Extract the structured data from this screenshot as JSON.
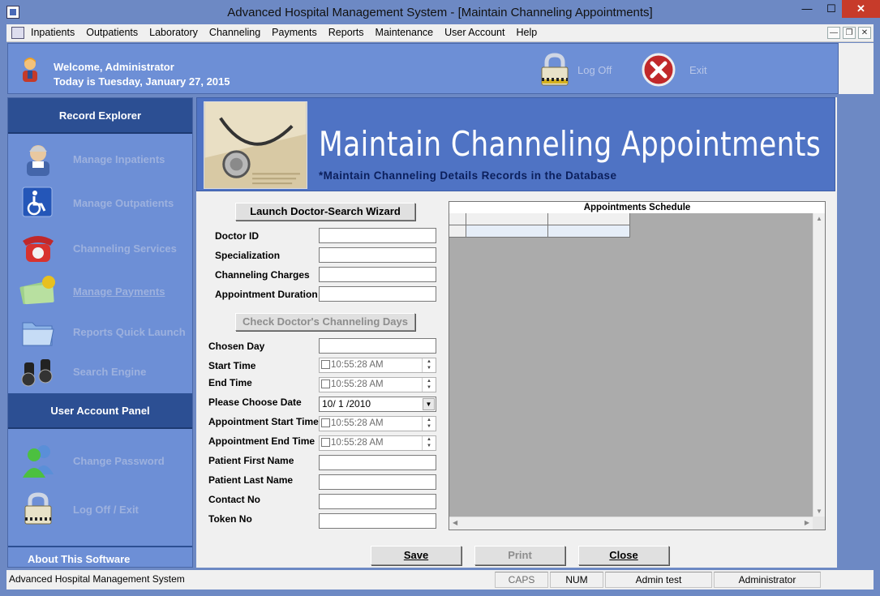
{
  "window": {
    "title": "Advanced Hospital Management System - [Maintain Channeling Appointments]",
    "minimize": "—",
    "maximize": "☐",
    "close": "✕"
  },
  "menu": {
    "items": [
      "Inpatients",
      "Outpatients",
      "Laboratory",
      "Channeling",
      "Payments",
      "Reports",
      "Maintenance",
      "User Account",
      "Help"
    ],
    "mdi_min": "—",
    "mdi_restore": "❐",
    "mdi_close": "✕"
  },
  "header": {
    "welcome": "Welcome, Administrator",
    "date": "Today is Tuesday, January 27, 2015",
    "logoff_label": "Log Off",
    "exit_label": "Exit"
  },
  "sidebar": {
    "record_explorer_title": "Record Explorer",
    "record_items": [
      {
        "label": "Manage Inpatients",
        "icon": "nurse-icon"
      },
      {
        "label": "Manage Outpatients",
        "icon": "wheelchair-icon"
      },
      {
        "label": "Channeling Services",
        "icon": "telephone-icon"
      },
      {
        "label": "Manage Payments",
        "icon": "money-icon"
      },
      {
        "label": "Reports Quick Launch",
        "icon": "folder-icon"
      },
      {
        "label": "Search Engine",
        "icon": "binoculars-icon"
      }
    ],
    "user_panel_title": "User Account Panel",
    "user_items": [
      {
        "label": "Change Password",
        "icon": "users-icon"
      },
      {
        "label": "Log Off / Exit",
        "icon": "padlock-icon"
      }
    ],
    "about": "About This Software"
  },
  "banner": {
    "title": "Maintain Channeling Appointments",
    "subtitle": "*Maintain Channeling Details Records in the Database"
  },
  "form": {
    "launch_wizard_button": "Launch Doctor-Search Wizard",
    "doctor_id_label": "Doctor ID",
    "doctor_id_value": "",
    "specialization_label": "Specialization",
    "specialization_value": "",
    "charges_label": "Channeling Charges",
    "charges_value": "",
    "duration_label": "Appointment Duration",
    "duration_value": "",
    "check_days_button": "Check Doctor's Channeling Days",
    "chosen_day_label": "Chosen Day",
    "chosen_day_value": "",
    "start_time_label": "Start Time",
    "start_time_value": "10:55:28 AM",
    "end_time_label": "End Time",
    "end_time_value": "10:55:28 AM",
    "choose_date_label": "Please Choose Date",
    "choose_date_value": "10/ 1 /2010",
    "appt_start_label": "Appointment Start Time",
    "appt_start_value": "10:55:28 AM",
    "appt_end_label": "Appointment End Time",
    "appt_end_value": "10:55:28 AM",
    "first_name_label": "Patient First Name",
    "first_name_value": "",
    "last_name_label": "Patient Last Name",
    "last_name_value": "",
    "contact_label": "Contact No",
    "contact_value": "",
    "token_label": "Token No",
    "token_value": ""
  },
  "schedule": {
    "title": "Appointments Schedule"
  },
  "actions": {
    "save": "Save",
    "print": "Print",
    "close": "Close"
  },
  "status": {
    "app": "Advanced Hospital Management System",
    "caps": "CAPS",
    "num": "NUM",
    "user": "Admin test",
    "role": "Administrator"
  },
  "colors": {
    "panel_blue": "#6d8fd6",
    "header_blue": "#2c4f93",
    "banner_blue": "#4f73c4",
    "close_red": "#c73b2a"
  }
}
